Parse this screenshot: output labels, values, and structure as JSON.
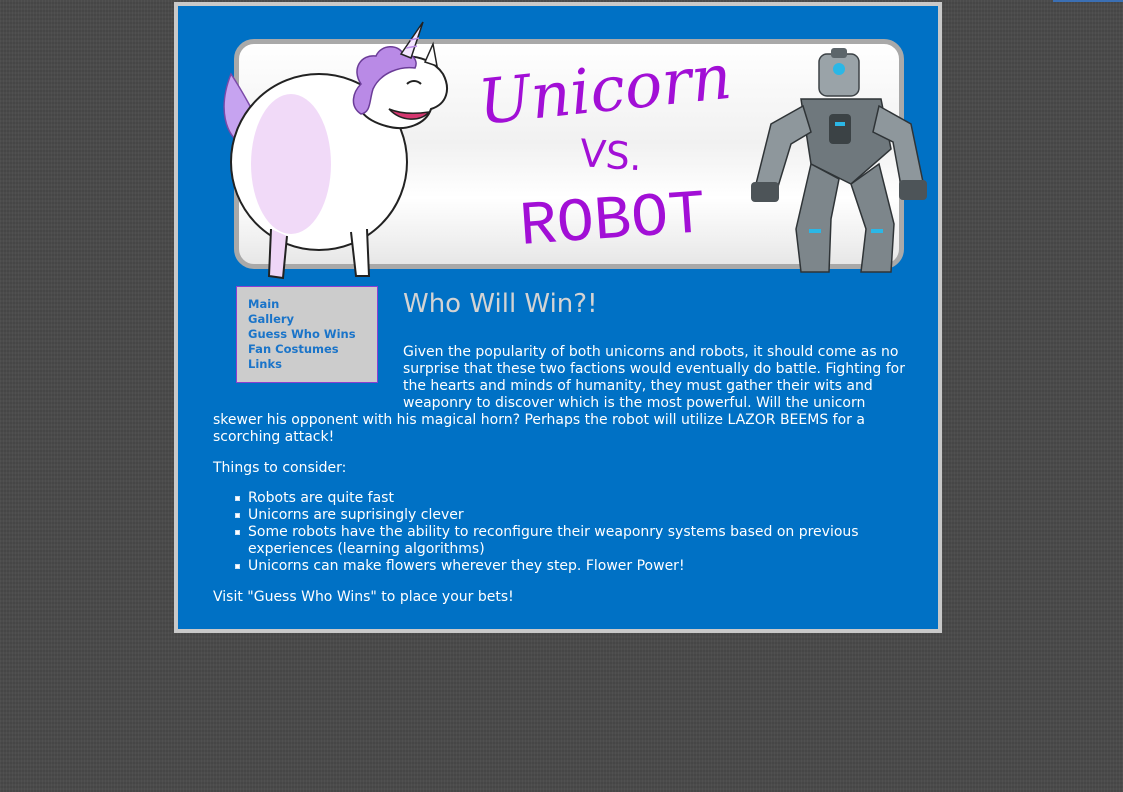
{
  "header": {
    "title_line1": "Unicorn",
    "title_line2": "VS.",
    "title_line3": "ROBOT"
  },
  "nav": {
    "items": [
      {
        "label": "Main"
      },
      {
        "label": "Gallery"
      },
      {
        "label": "Guess Who Wins"
      },
      {
        "label": "Fan Costumes"
      },
      {
        "label": "Links"
      }
    ]
  },
  "main": {
    "heading": "Who Will Win?!",
    "intro": "Given the popularity of both unicorns and robots, it should come as no surprise that these two factions would eventually do battle. Fighting for the hearts and minds of humanity, they must gather their wits and weaponry to discover which is the most powerful. Will the unicorn skewer his opponent with his magical horn? Perhaps the robot will utilize LAZOR BEEMS for a scorching attack!",
    "consider_label": "Things to consider:",
    "points": [
      "Robots are quite fast",
      "Unicorns are suprisingly clever",
      "Some robots have the ability to reconfigure their weaponry systems based on previous experiences (learning algorithms)",
      "Unicorns can make flowers wherever they step. Flower Power!"
    ],
    "cta": "Visit \"Guess Who Wins\" to place your bets!"
  },
  "colors": {
    "page_bg": "#4a4a4a",
    "content_bg": "#0071c5",
    "frame": "#c9c9c9",
    "title_purple": "#a20fd6",
    "nav_link": "#1a74c9"
  },
  "icons": [
    "unicorn-illustration",
    "robot-illustration"
  ]
}
